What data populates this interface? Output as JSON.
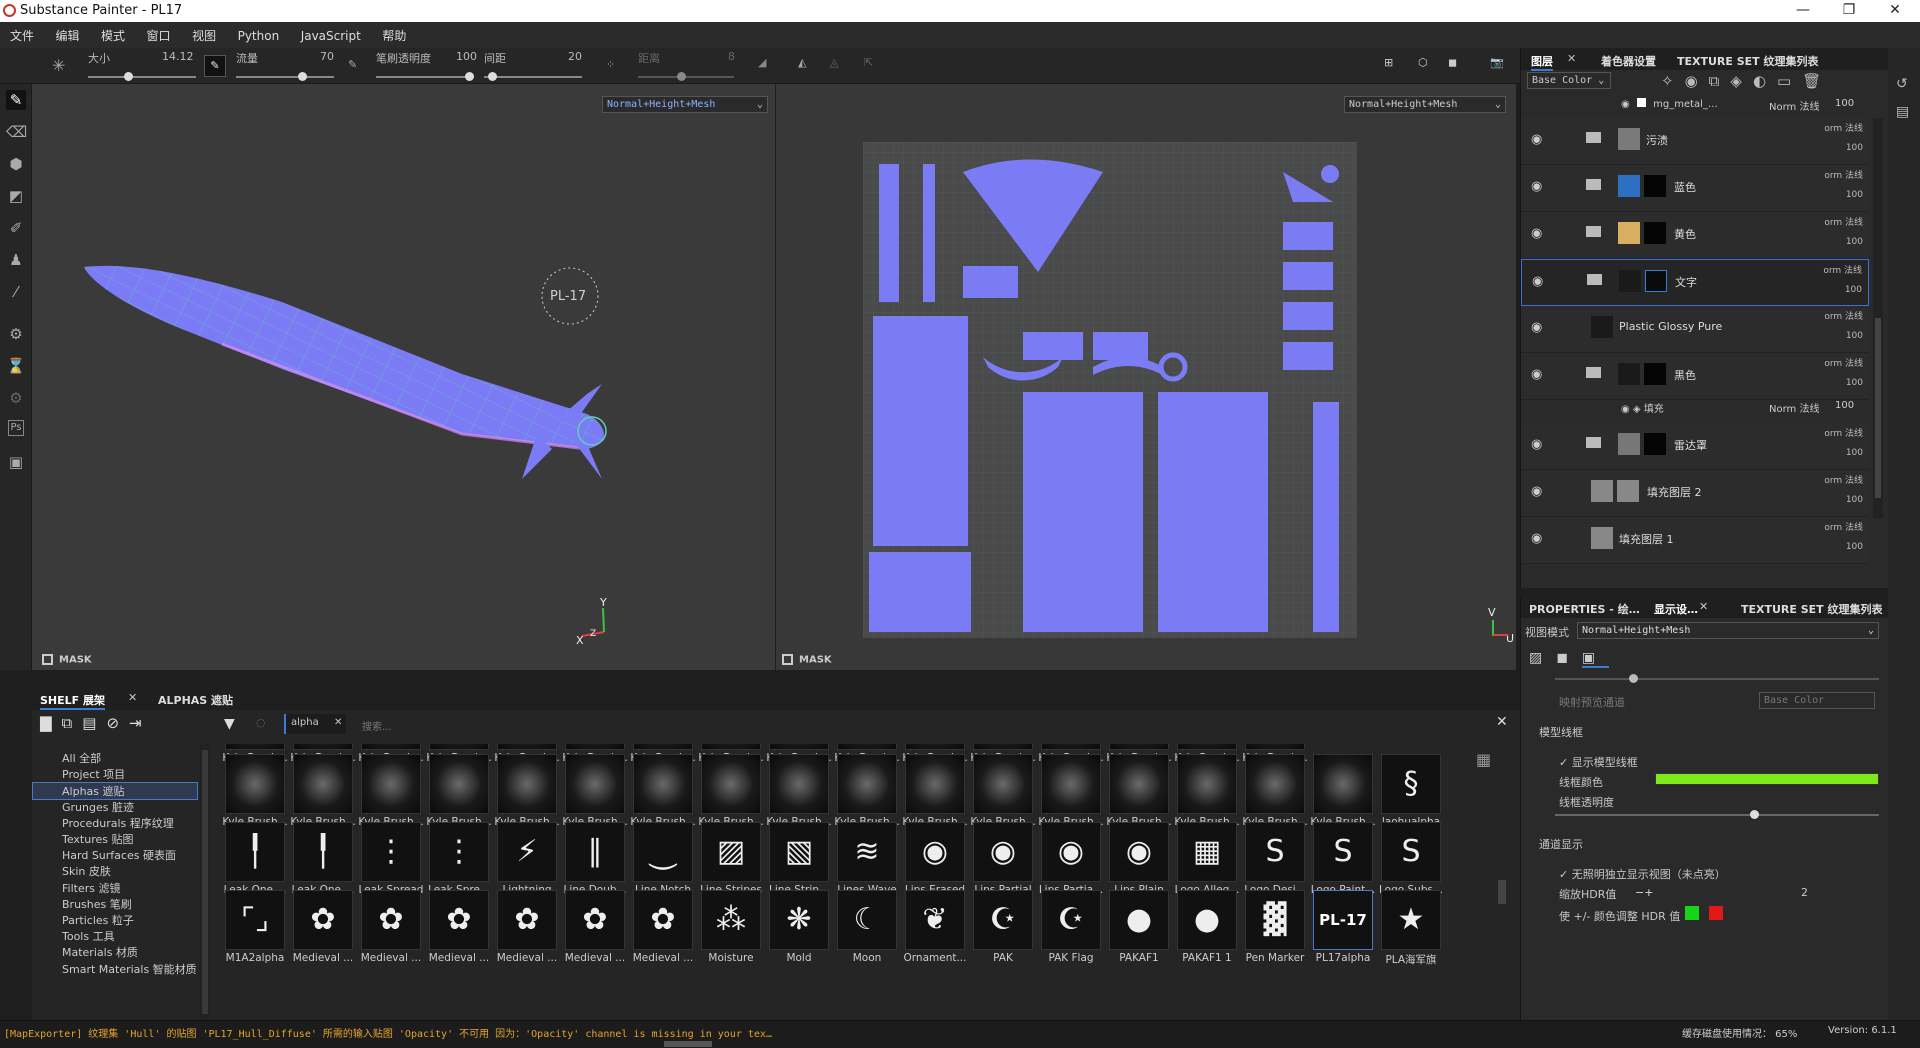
{
  "window": {
    "title": "Substance Painter - PL17",
    "minimize": "—",
    "maximize": "❐",
    "close": "✕"
  },
  "menu": [
    "文件",
    "编辑",
    "模式",
    "窗口",
    "视图",
    "Python",
    "JavaScript",
    "帮助"
  ],
  "toolbar": {
    "size_label": "大小",
    "size_value": "14.12",
    "flow_label": "流量",
    "flow_value": "70",
    "opacity_label": "笔刷透明度",
    "opacity_value": "100",
    "spacing_label": "间距",
    "spacing_value": "20",
    "angle_label": "距离",
    "angle_value": "8",
    "sliders": {
      "size": 0.36,
      "flow": 0.7,
      "opacity": 1.0,
      "spacing": 0.05,
      "angle": 0.45
    }
  },
  "viewport": {
    "mode_3d": "Normal+Height+Mesh",
    "mode_2d": "Normal+Height+Mesh",
    "mask_label": "MASK",
    "badge_text": "PL-17",
    "axis_y": "Y",
    "axis_x": "X",
    "axis_z": "Z",
    "axis_u": "U",
    "axis_v": "V",
    "mesh_color": "#7b7cf5",
    "wire_color": "#5fd1b5"
  },
  "layers_panel": {
    "tabs": [
      "图层",
      "着色器设置",
      "TEXTURE SET 纹理集列表"
    ],
    "channel": "Base Color",
    "top_sublayer": {
      "name": "mg_metal_…",
      "blend": "Norm 法线",
      "opacity": "100"
    },
    "layers": [
      {
        "name": "污渍",
        "blend": "orm 法线",
        "opacity": "100",
        "thumb": "#7a7a7a",
        "mask": "none",
        "folder": true
      },
      {
        "name": "蓝色",
        "blend": "orm 法线",
        "opacity": "100",
        "thumb": "#2d6fc1",
        "mask": "black",
        "folder": true
      },
      {
        "name": "黄色",
        "blend": "orm 法线",
        "opacity": "100",
        "thumb": "#d8b060",
        "mask": "black",
        "folder": true
      },
      {
        "name": "文字",
        "blend": "orm 法线",
        "opacity": "100",
        "thumb": "#1a1a1a",
        "mask": "blue",
        "folder": true,
        "selected": true
      },
      {
        "name": "Plastic Glossy Pure",
        "blend": "orm 法线",
        "opacity": "100",
        "thumb": "#1a1a1a",
        "mask": "none",
        "folder": false
      },
      {
        "name": "黑色",
        "blend": "orm 法线",
        "opacity": "100",
        "thumb": "#1a1a1a",
        "mask": "black",
        "folder": true
      },
      {
        "name": "雷达罩",
        "blend": "orm 法线",
        "opacity": "100",
        "thumb": "#777777",
        "mask": "black",
        "folder": true
      },
      {
        "name": "填充图层 2",
        "blend": "orm 法线",
        "opacity": "100",
        "thumb": "#888888",
        "mask": "grey",
        "folder": false
      },
      {
        "name": "填充图层 1",
        "blend": "orm 法线",
        "opacity": "100",
        "thumb": "#888888",
        "mask": "none",
        "folder": false
      }
    ],
    "fill_sublayer": {
      "name": "填充",
      "blend": "Norm 法线",
      "opacity": "100"
    }
  },
  "props_panel": {
    "tabs": [
      "PROPERTIES - 绘…",
      "显示设…",
      "TEXTURE SET 纹理集列表"
    ],
    "view_mode_label": "视图模式",
    "view_mode_value": "Normal+Height+Mesh",
    "preview_channel_label": "映射预览通道",
    "preview_channel_value": "Base Color",
    "wire_section": "模型线框",
    "show_wire": "显示模型线框",
    "wire_color_label": "线框颜色",
    "wire_color": "#7fe81a",
    "wire_opacity_label": "线框透明度",
    "wire_opacity": 0.62,
    "channel_section": "通道显示",
    "unlit": "无照明独立显示视图（未点亮）",
    "hdr_label": "缩放HDR值",
    "hdr_value": "2",
    "hdr_adjust": "使 +/- 颜色调整 HDR 值",
    "hdr_minus_color": "#17d417",
    "hdr_plus_color": "#e01818"
  },
  "shelf": {
    "tab1": "SHELF 展架",
    "tab2": "ALPHAS 遮贴",
    "filter_tag": "alpha",
    "search_placeholder": "搜索...",
    "categories": [
      "All 全部",
      "Project 项目",
      "Alphas 遮贴",
      "Grunges 脏迹",
      "Procedurals 程序纹理",
      "Textures 贴图",
      "Hard Surfaces 硬表面",
      "Skin 皮肤",
      "Filters 滤镜",
      "Brushes 笔刷",
      "Particles 粒子",
      "Tools 工具",
      "Materials 材质",
      "Smart Materials 智能材质"
    ],
    "selected_category": 2,
    "row0": [
      "Kyle Brush...",
      "Kyle Brush...",
      "Kyle Brush...",
      "Kyle Brush...",
      "Kyle Brush...",
      "Kyle Brush...",
      "Kyle Brush...",
      "Kyle Brush...",
      "Kyle Brush...",
      "Kyle Brush...",
      "Kyle Brush...",
      "Kyle Brush...",
      "Kyle Brush...",
      "Kyle Brush...",
      "Kyle Brush...",
      "Kyle Brush..."
    ],
    "row1": [
      "Kyle Brush...",
      "Kyle Brush...",
      "Kyle Brush...",
      "Kyle Brush...",
      "Kyle Brush...",
      "Kyle Brush...",
      "Kyle Brush...",
      "Kyle Brush...",
      "Kyle Brush...",
      "Kyle Brush...",
      "Kyle Brush...",
      "Kyle Brush...",
      "Kyle Brush...",
      "Kyle Brush...",
      "Kyle Brush...",
      "Kyle Brush...",
      "Kyle Brush...",
      "laohualpha"
    ],
    "row2": [
      "Leak One ...",
      "Leak One ...",
      "Leak Spread",
      "Leak Spre...",
      "Lightning",
      "Line Doub...",
      "Line Notch",
      "Line Stripes",
      "Line Strip...",
      "Lines Wave",
      "Lips Erased",
      "Lips Partial",
      "Lips Partia...",
      "Lips Plain",
      "Logo Alleg...",
      "Logo Desi...",
      "Logo Paint...",
      "Logo Subs..."
    ],
    "row3": [
      "M1A2alpha",
      "Medieval ...",
      "Medieval ...",
      "Medieval ...",
      "Medieval ...",
      "Medieval ...",
      "Medieval ...",
      "Moisture",
      "Mold",
      "Moon",
      "Ornament...",
      "PAK",
      "PAK Flag",
      "PAKAF1",
      "PAKAF1 1",
      "Pen Marker",
      "PL17alpha",
      "PLA海军旗"
    ],
    "selected_alpha": "PL17alpha",
    "pl17_text": "PL-17"
  },
  "status": {
    "message": "[MapExporter] 纹理集 'Hull' 的贴图 'PL17_Hull_Diffuse' 所需的输入贴图 'Opacity' 不可用 因为：'Opacity' channel is missing in your tex…",
    "cache": "缓存磁盘使用情况：  65%",
    "version": "Version: 6.1.1"
  }
}
